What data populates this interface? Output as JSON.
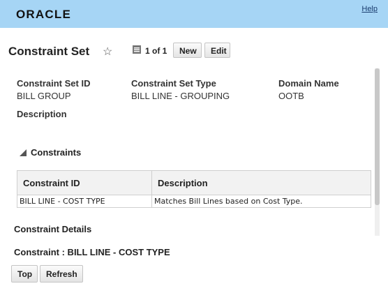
{
  "header": {
    "logo": "ORACLE",
    "help": "Help"
  },
  "page": {
    "title": "Constraint Set",
    "paging": "1 of 1",
    "new_label": "New",
    "edit_label": "Edit"
  },
  "fields": {
    "id_label": "Constraint Set ID",
    "id_value": "BILL GROUP",
    "type_label": "Constraint Set Type",
    "type_value": "BILL LINE - GROUPING",
    "domain_label": "Domain Name",
    "domain_value": "OOTB",
    "description_label": "Description"
  },
  "constraints": {
    "title": "Constraints",
    "columns": [
      "Constraint ID",
      "Description"
    ],
    "rows": [
      [
        "BILL LINE - COST TYPE",
        "Matches Bill Lines based on Cost Type."
      ]
    ]
  },
  "details": {
    "title": "Constraint Details",
    "constraint_title": "Constraint : BILL LINE - COST TYPE",
    "top_label": "Top",
    "refresh_label": "Refresh"
  },
  "icons": {
    "favorite": "star-icon",
    "document": "document-icon",
    "disclosure": "triangle-down-icon"
  }
}
